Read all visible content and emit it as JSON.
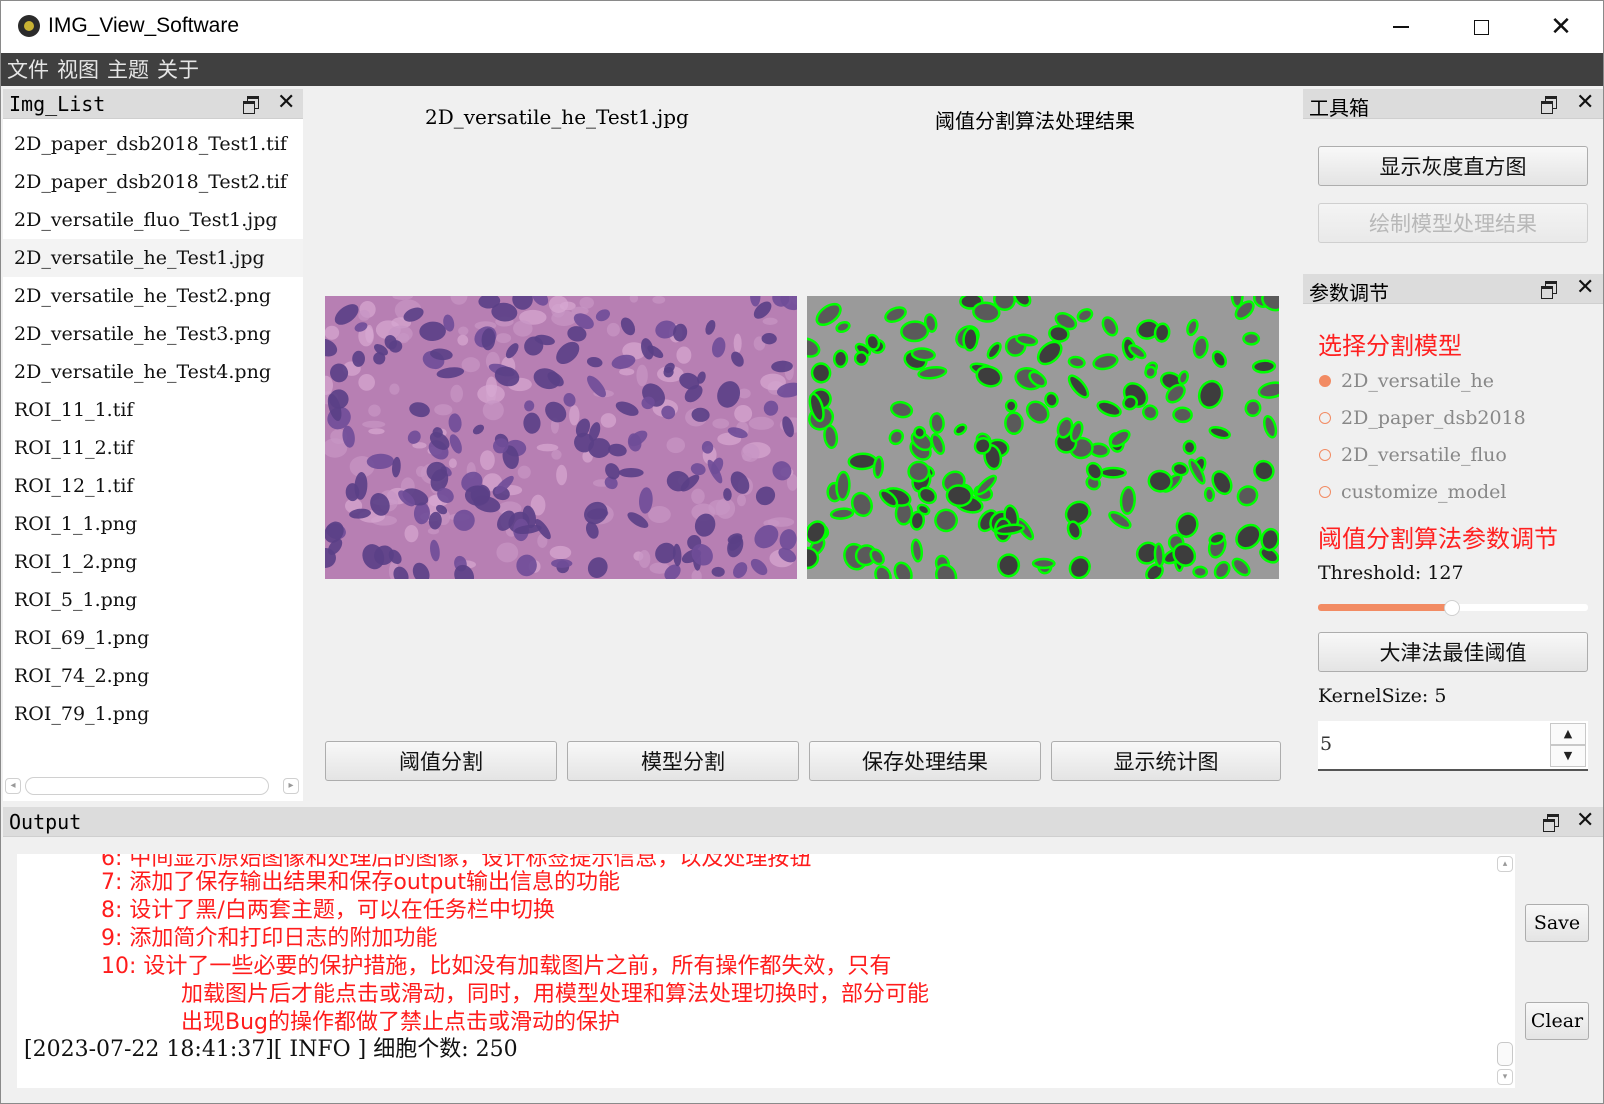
{
  "window": {
    "title": "IMG_View_Software"
  },
  "menu": {
    "items": [
      "文件",
      "视图",
      "主题",
      "关于"
    ]
  },
  "img_list": {
    "title": "Img_List",
    "items": [
      "2D_paper_dsb2018_Test1.tif",
      "2D_paper_dsb2018_Test2.tif",
      "2D_versatile_fluo_Test1.jpg",
      "2D_versatile_he_Test1.jpg",
      "2D_versatile_he_Test2.png",
      "2D_versatile_he_Test3.png",
      "2D_versatile_he_Test4.png",
      "ROI_11_1.tif",
      "ROI_11_2.tif",
      "ROI_12_1.tif",
      "ROI_1_1.png",
      "ROI_1_2.png",
      "ROI_5_1.png",
      "ROI_69_1.png",
      "ROI_74_2.png",
      "ROI_79_1.png"
    ],
    "selected": "2D_versatile_he_Test1.jpg"
  },
  "viewer": {
    "left_caption": "2D_versatile_he_Test1.jpg",
    "right_caption": "阈值分割算法处理结果",
    "buttons": [
      "阈值分割",
      "模型分割",
      "保存处理结果",
      "显示统计图"
    ]
  },
  "toolbox": {
    "title": "工具箱",
    "btn_histogram": "显示灰度直方图",
    "btn_draw_model": "绘制模型处理结果"
  },
  "params": {
    "title": "参数调节",
    "model_heading": "选择分割模型",
    "models": [
      "2D_versatile_he",
      "2D_paper_dsb2018",
      "2D_versatile_fluo",
      "customize_model"
    ],
    "selected_model": "2D_versatile_he",
    "algo_heading": "阈值分割算法参数调节",
    "threshold_label": "Threshold: 127",
    "threshold_value": 127,
    "threshold_max": 255,
    "otsu_button": "大津法最佳阈值",
    "kernel_label": "KernelSize: 5",
    "kernel_value": "5"
  },
  "output": {
    "title": "Output",
    "lines": [
      "7: 添加了保存输出结果和保存output输出信息的功能",
      "8: 设计了黑/白两套主题，可以在任务栏中切换",
      "9: 添加简介和打印日志的附加功能",
      "10: 设计了一些必要的保护措施，比如没有加载图片之前，所有操作都失效，只有",
      "加载图片后才能点击或滑动，同时，用模型处理和算法处理切换时，部分可能",
      "出现Bug的操作都做了禁止点击或滑动的保护"
    ],
    "log_line": "[2023-07-22 18:41:37][ INFO  ] 细胞个数: 250",
    "save_button": "Save",
    "clear_button": "Clear"
  },
  "colors": {
    "accent": "#f28b63",
    "red_text": "#ff1c1c",
    "menubar": "#404040",
    "contour": "#00ff00"
  }
}
